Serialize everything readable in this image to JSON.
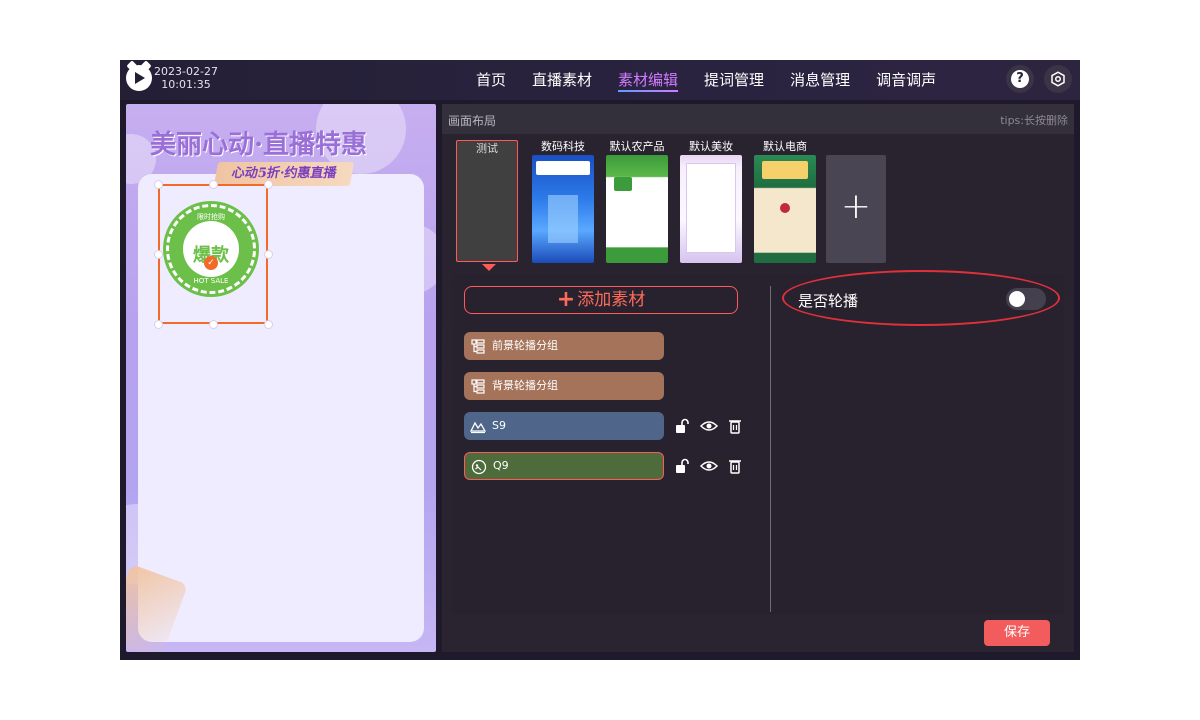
{
  "header": {
    "date": "2023-02-27",
    "time": "10:01:35",
    "nav": [
      {
        "label": "首页"
      },
      {
        "label": "直播素材"
      },
      {
        "label": "素材编辑",
        "active": true
      },
      {
        "label": "提词管理"
      },
      {
        "label": "消息管理"
      },
      {
        "label": "调音调声"
      }
    ],
    "help_icon": "question-icon",
    "settings_icon": "settings-icon"
  },
  "preview": {
    "banner_title": "美丽心动·直播特惠",
    "banner_subtitle": "心动5折·约惠直播",
    "badge": {
      "top_text": "限时抢购",
      "main_text": "爆款",
      "bottom_text": "HOT SALE"
    }
  },
  "panel": {
    "title": "画面布局",
    "tips": "tips:长按删除",
    "layouts": [
      {
        "name": "测试",
        "selected": true
      },
      {
        "name": "数码科技"
      },
      {
        "name": "默认农产品"
      },
      {
        "name": "默认美妆"
      },
      {
        "name": "默认电商"
      }
    ],
    "add_layout_icon": "plus-icon"
  },
  "editor": {
    "add_material_label": "添加素材",
    "layers": [
      {
        "label": "前景轮播分组",
        "type": "group",
        "icon": "group-icon"
      },
      {
        "label": "背景轮播分组",
        "type": "group",
        "icon": "group-icon"
      },
      {
        "label": "S9",
        "type": "image",
        "icon": "image-icon",
        "color": "#4f668a"
      },
      {
        "label": "Q9",
        "type": "sticker",
        "icon": "sticker-icon",
        "color": "#4e6b3c",
        "selected": true
      }
    ],
    "carousel_label": "是否轮播",
    "carousel_enabled": false
  },
  "footer": {
    "save_label": "保存"
  },
  "colors": {
    "accent": "#f25c5c",
    "nav_active": "#d07bff",
    "background": "#1e1a2b"
  }
}
